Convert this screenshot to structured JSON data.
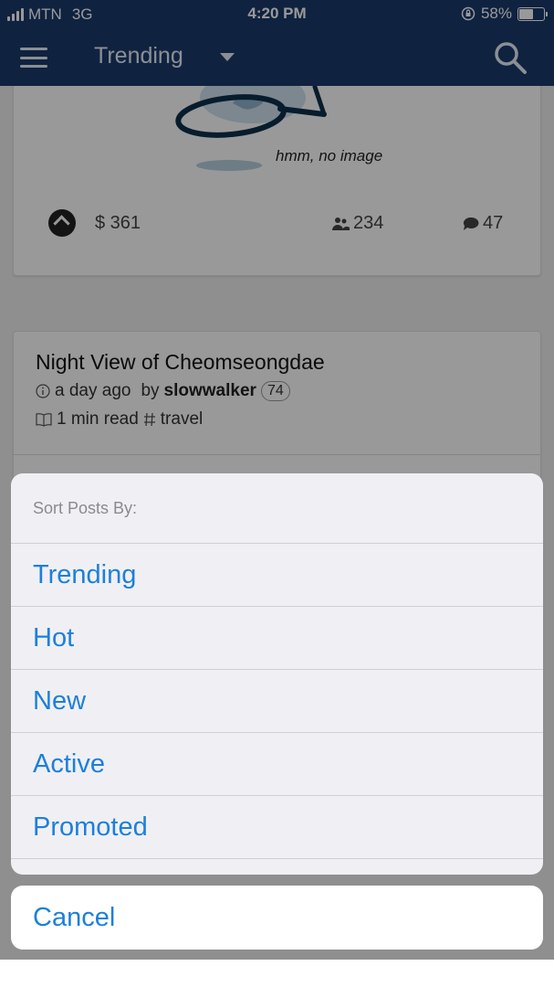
{
  "status_bar": {
    "carrier": "MTN",
    "network": "3G",
    "time": "4:20 PM",
    "battery": "58%",
    "battery_level": 0.58
  },
  "header": {
    "title": "Trending"
  },
  "card1": {
    "no_image_text": "hmm, no image",
    "payout": "$ 361",
    "voters": "234",
    "comments": "47"
  },
  "card2": {
    "title": "Night View of Cheomseongdae",
    "time_ago": "a day ago",
    "by": "by",
    "author": "slowwalker",
    "reputation": "74",
    "read_time": "1 min read",
    "tag": "travel"
  },
  "sort_sheet": {
    "header": "Sort Posts By:",
    "options": [
      "Trending",
      "Hot",
      "New",
      "Active",
      "Promoted"
    ],
    "cancel": "Cancel"
  },
  "colors": {
    "header_bg": "#1a3a6b",
    "accent": "#1d7fdc"
  }
}
